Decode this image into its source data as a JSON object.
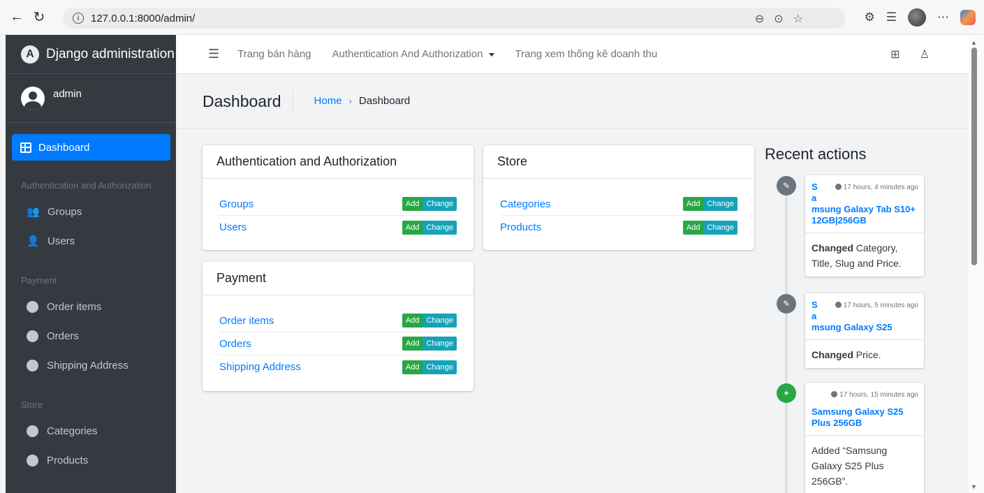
{
  "browser": {
    "url": "127.0.0.1:8000/admin/",
    "back_icon": "arrow-left-icon",
    "reload_icon": "reload-icon"
  },
  "sidebar": {
    "brand": "Django administration",
    "user": "admin",
    "active_item": "Dashboard",
    "sections": [
      {
        "header": "Authentication and Authorization",
        "items": [
          "Groups",
          "Users"
        ]
      },
      {
        "header": "Payment",
        "items": [
          "Order items",
          "Orders",
          "Shipping Address"
        ]
      },
      {
        "header": "Store",
        "items": [
          "Categories",
          "Products"
        ]
      }
    ]
  },
  "topnav": {
    "links": [
      "Trang bán hàng",
      "Authentication And Authorization",
      "Trang xem thống kê doanh thu"
    ]
  },
  "header": {
    "title": "Dashboard",
    "breadcrumb_home": "Home",
    "breadcrumb_sep": "›",
    "breadcrumb_current": "Dashboard"
  },
  "buttons": {
    "add": "Add",
    "change": "Change"
  },
  "apps": {
    "auth": {
      "title": "Authentication and Authorization",
      "models": [
        "Groups",
        "Users"
      ]
    },
    "store": {
      "title": "Store",
      "models": [
        "Categories",
        "Products"
      ]
    },
    "payment": {
      "title": "Payment",
      "models": [
        "Order items",
        "Orders",
        "Shipping Address"
      ]
    }
  },
  "recent": {
    "title": "Recent actions",
    "actions": [
      {
        "type": "changed",
        "object_l1": "S",
        "object_l2": "a",
        "object_l3": "msung Galaxy Tab S10+ 12GB|256GB",
        "time": "17 hours, 4 minutes ago",
        "verb": "Changed",
        "detail": " Category, Title, Slug and Price."
      },
      {
        "type": "changed",
        "object_l1": "S",
        "object_l2": "a",
        "object_l3": "msung Galaxy S25",
        "time": "17 hours, 5 minutes ago",
        "verb": "Changed",
        "detail": " Price."
      },
      {
        "type": "added",
        "object_l3": "Samsung Galaxy S25 Plus 256GB",
        "time": "17 hours, 15 minutes ago",
        "detail": "Added “Samsung Galaxy S25 Plus 256GB”."
      }
    ]
  },
  "colors": {
    "primary": "#007bff",
    "add": "#28a745",
    "change": "#17a2b8",
    "sidebar": "#343a40"
  }
}
